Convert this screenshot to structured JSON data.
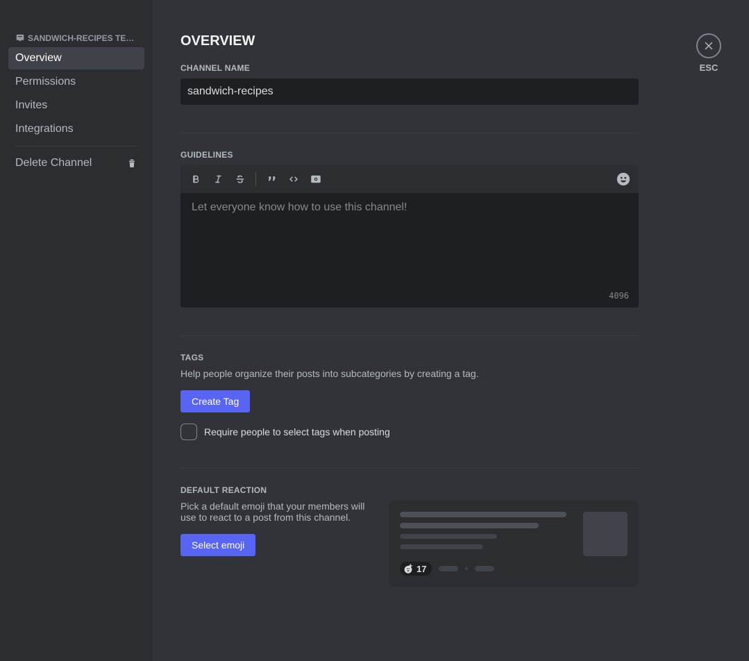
{
  "sidebar": {
    "header": "SANDWICH-RECIPES TE…",
    "items": [
      {
        "label": "Overview",
        "active": true
      },
      {
        "label": "Permissions",
        "active": false
      },
      {
        "label": "Invites",
        "active": false
      },
      {
        "label": "Integrations",
        "active": false
      }
    ],
    "delete_label": "Delete Channel"
  },
  "close": {
    "label": "ESC"
  },
  "page": {
    "title": "OVERVIEW"
  },
  "channel_name": {
    "label": "CHANNEL NAME",
    "value": "sandwich-recipes"
  },
  "guidelines": {
    "label": "GUIDELINES",
    "placeholder": "Let everyone know how to use this channel!",
    "char_limit": "4096"
  },
  "tags": {
    "label": "TAGS",
    "help": "Help people organize their posts into subcategories by creating a tag.",
    "create_button": "Create Tag",
    "require_label": "Require people to select tags when posting"
  },
  "default_reaction": {
    "label": "DEFAULT REACTION",
    "help": "Pick a default emoji that your members will use to react to a post from this channel.",
    "select_button": "Select emoji",
    "count": "17"
  }
}
